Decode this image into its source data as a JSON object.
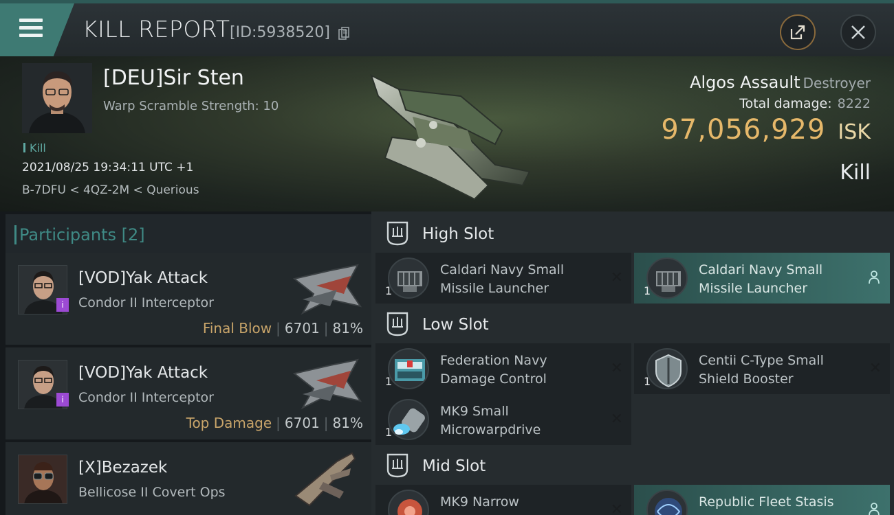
{
  "header": {
    "title": "KILL REPORT",
    "id_label": "[ID:5938520]"
  },
  "victim": {
    "name": "[DEU]Sir Sten",
    "subtitle": "Warp Scramble Strength: 10",
    "kill_tag": "Kill",
    "datetime": "2021/08/25 19:34:11 UTC +1",
    "location": "B-7DFU < 4QZ-2M < Querious",
    "ship_name": "Algos Assault",
    "ship_class": "Destroyer",
    "damage_label": "Total damage:",
    "damage_value": "8222",
    "isk_value": "97,056,929",
    "isk_unit": "ISK",
    "report_type": "Kill"
  },
  "participants": {
    "label": "Participants",
    "count": "[2]",
    "rows": [
      {
        "name": "[VOD]Yak Attack",
        "ship": "Condor II Interceptor",
        "tag": "Final Blow",
        "damage": "6701",
        "percent": "81%"
      },
      {
        "name": "[VOD]Yak Attack",
        "ship": "Condor II Interceptor",
        "tag": "Top Damage",
        "damage": "6701",
        "percent": "81%"
      },
      {
        "name": "[X]Bezazek",
        "ship": "Bellicose II Covert Ops",
        "tag": "",
        "damage": "",
        "percent": ""
      }
    ]
  },
  "fitting": {
    "high_label": "High Slot",
    "low_label": "Low Slot",
    "mid_label": "Mid Slot",
    "high": [
      {
        "line1": "Caldari Navy Small",
        "line2": "Missile Launcher",
        "qty": "1"
      },
      {
        "line1": "Caldari Navy Small",
        "line2": "Missile Launcher",
        "qty": "1"
      }
    ],
    "low": [
      {
        "line1": "Federation Navy",
        "line2": "Damage Control",
        "qty": "1"
      },
      {
        "line1": "Centii C-Type Small",
        "line2": "Shield Booster",
        "qty": "1"
      },
      {
        "line1": "MK9 Small",
        "line2": "Microwarpdrive",
        "qty": "1"
      }
    ],
    "mid": [
      {
        "line1": "MK9 Narrow",
        "line2": "",
        "qty": ""
      },
      {
        "line1": "Republic Fleet Stasis",
        "line2": "",
        "qty": ""
      }
    ],
    "close_glyph": "✕"
  }
}
